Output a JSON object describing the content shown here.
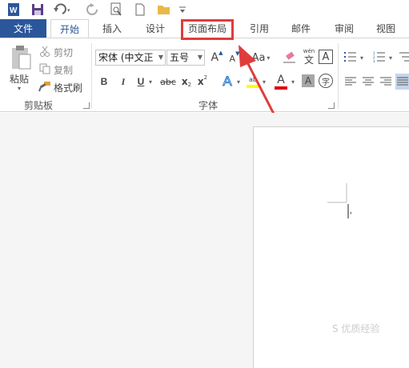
{
  "quick_access": {
    "app_icon": "word-icon",
    "save": "save-icon",
    "undo": "undo-icon",
    "redo": "redo-icon",
    "print_preview": "print-preview-icon",
    "new": "new-document-icon",
    "open": "open-folder-icon",
    "customize": "customize-qat-icon"
  },
  "tabs": [
    {
      "label": "文件"
    },
    {
      "label": "开始"
    },
    {
      "label": "插入"
    },
    {
      "label": "设计"
    },
    {
      "label": "页面布局"
    },
    {
      "label": "引用"
    },
    {
      "label": "邮件"
    },
    {
      "label": "审阅"
    },
    {
      "label": "视图"
    }
  ],
  "clipboard": {
    "paste": "粘贴",
    "cut": "剪切",
    "copy": "复制",
    "format_painter": "格式刷",
    "group_label": "剪贴板"
  },
  "font": {
    "font_name": "宋体 (中文正",
    "font_size": "五号",
    "grow_font": "A",
    "shrink_font": "A",
    "change_case": "Aa",
    "clear_format": "clear-formatting-icon",
    "phonetic_top": "wén",
    "phonetic_bottom": "文",
    "char_border": "A",
    "bold": "B",
    "italic": "I",
    "underline": "U",
    "strike": "abc",
    "subscript": "x",
    "superscript": "x",
    "sub_mark": "2",
    "sup_mark": "2",
    "text_effects": "A",
    "highlight": "ab",
    "font_color": "A",
    "char_shading": "A",
    "enclose": "字",
    "group_label": "字体"
  },
  "colors": {
    "brand": "#2b579a",
    "annotation": "#e03c3c",
    "highlight_yellow": "#ffff00",
    "font_red": "#e00000"
  },
  "watermark": "S 优质经验"
}
